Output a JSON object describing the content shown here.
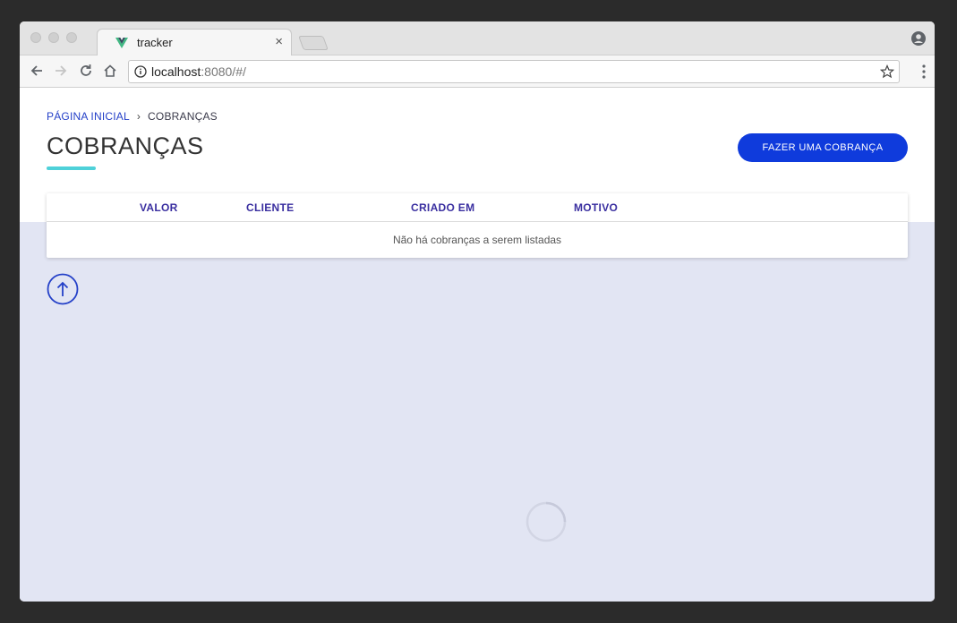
{
  "browser": {
    "tab_title": "tracker",
    "tab_close": "×",
    "url_host": "localhost",
    "url_rest": ":8080/#/"
  },
  "page": {
    "breadcrumb": {
      "home": "PÁGINA INICIAL",
      "separator": "›",
      "current": "COBRANÇAS"
    },
    "title": "COBRANÇAS",
    "primary_button": "FAZER UMA COBRANÇA",
    "table": {
      "columns": [
        "VALOR",
        "CLIENTE",
        "CRIADO EM",
        "MOTIVO"
      ],
      "empty_message": "Não há cobranças a serem listadas"
    }
  },
  "colors": {
    "accent": "#0f3bdc",
    "underline": "#4fd1d9",
    "background": "#e2e5f3",
    "header_text": "#3a2fa0"
  }
}
